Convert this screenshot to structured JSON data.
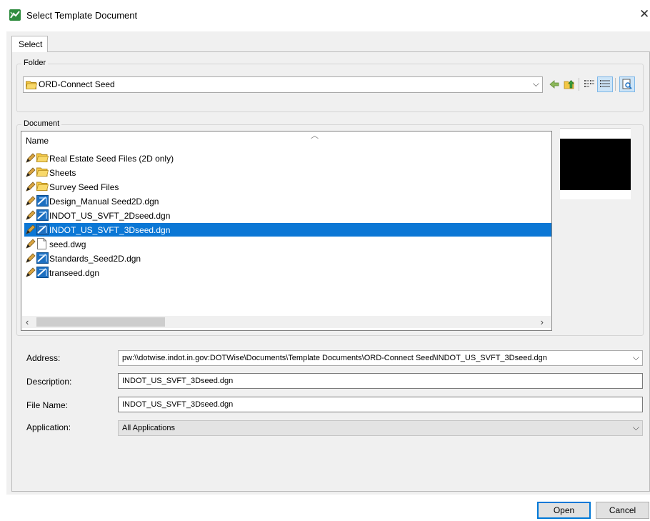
{
  "window": {
    "title": "Select Template Document",
    "close_glyph": "✕"
  },
  "tabs": [
    {
      "label": "Select",
      "active": true
    }
  ],
  "folder": {
    "label": "Folder",
    "current": "ORD-Connect Seed",
    "toolbar": [
      "back-arrow-icon",
      "up-folder-icon",
      "list-view-icon",
      "details-view-icon",
      "preview-icon"
    ]
  },
  "document": {
    "label": "Document",
    "column_header": "Name",
    "items": [
      {
        "name": "Real Estate Seed Files (2D only)",
        "kind": "folder",
        "selected": false
      },
      {
        "name": "Sheets",
        "kind": "folder",
        "selected": false
      },
      {
        "name": "Survey Seed Files",
        "kind": "folder",
        "selected": false
      },
      {
        "name": "Design_Manual Seed2D.dgn",
        "kind": "dgn",
        "selected": false
      },
      {
        "name": "INDOT_US_SVFT_2Dseed.dgn",
        "kind": "dgn",
        "selected": false
      },
      {
        "name": "INDOT_US_SVFT_3Dseed.dgn",
        "kind": "dgn",
        "selected": true
      },
      {
        "name": "seed.dwg",
        "kind": "dwg",
        "selected": false
      },
      {
        "name": "Standards_Seed2D.dgn",
        "kind": "dgn",
        "selected": false
      },
      {
        "name": "transeed.dgn",
        "kind": "dgn",
        "selected": false
      }
    ]
  },
  "fields": {
    "address_label": "Address:",
    "address_value": "pw:\\\\dotwise.indot.in.gov:DOTWise\\Documents\\Template Documents\\ORD-Connect Seed\\INDOT_US_SVFT_3Dseed.dgn",
    "description_label": "Description:",
    "description_value": "INDOT_US_SVFT_3Dseed.dgn",
    "filename_label": "File Name:",
    "filename_value": "INDOT_US_SVFT_3Dseed.dgn",
    "application_label": "Application:",
    "application_value": "All Applications"
  },
  "buttons": {
    "open": "Open",
    "cancel": "Cancel"
  },
  "colors": {
    "selection": "#0b77d5",
    "dialog_bg": "#f0f0f0",
    "folder_yellow": "#f3c744",
    "dgn_blue": "#1d6fc0"
  }
}
